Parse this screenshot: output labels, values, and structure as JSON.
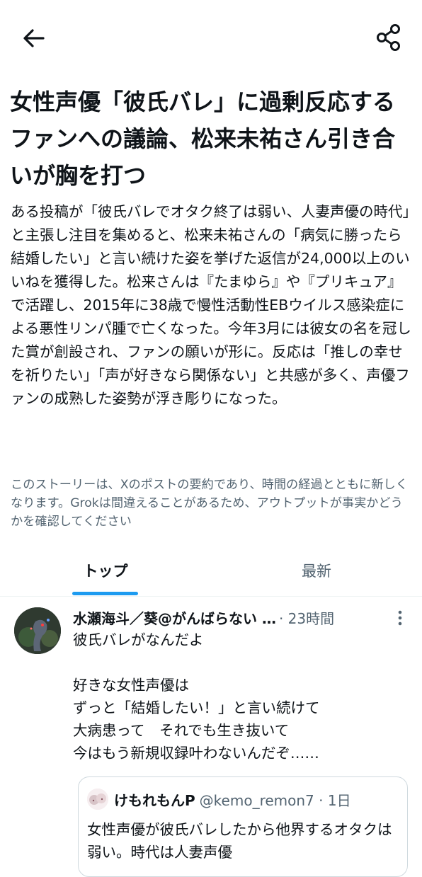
{
  "header": {
    "back_icon": "arrow-left-icon",
    "share_icon": "share-icon"
  },
  "story": {
    "title": "女性声優「彼氏バレ」に過剰反応するファンへの議論、松来未祐さん引き合いが胸を打つ",
    "summary": "ある投稿が「彼氏バレでオタク終了は弱い、人妻声優の時代」と主張し注目を集めると、松来未祐さんの「病気に勝ったら結婚したい」と言い続けた姿を挙げた返信が24,000以上のいいねを獲得した。松来さんは『たまゆら』や『プリキュア』で活躍し、2015年に38歳で慢性活動性EBウイルス感染症による悪性リンパ腫で亡くなった。今年3月には彼女の名を冠した賞が創設され、ファンの願いが形に。反応は「推しの幸せを祈りたい」「声が好きなら関係ない」と共感が多く、声優ファンの成熟した姿勢が浮き彫りになった。",
    "disclaimer": "このストーリーは、Xのポストの要約であり、時間の経過とともに新しくなります。Grokは間違えることがあるため、アウトプットが事実かどうかを確認してください"
  },
  "tabs": {
    "top": "トップ",
    "latest": "最新",
    "active": "top",
    "accent_color": "#1d9bf0"
  },
  "post": {
    "author": "水瀬海斗／葵@がんばらない …",
    "meta": "· 23時間",
    "more_icon": "more-vertical-icon",
    "text": "彼氏バレがなんだよ\n\n好きな女性声優は\nずっと「結婚したい！」と言い続けて\n大病患って　それでも生き抜いて\n今はもう新規収録叶わないんだぞ……",
    "quote": {
      "author": "けもれもんP",
      "handle": "@kemo_remon7 · 1日",
      "text": "女性声優が彼氏バレしたから他界するオタクは弱い。時代は人妻声優"
    }
  }
}
